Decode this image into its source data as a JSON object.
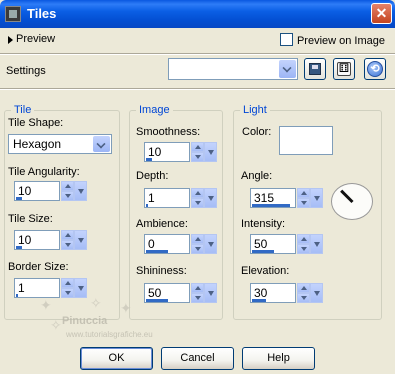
{
  "window": {
    "title": "Tiles",
    "close_glyph": "✕"
  },
  "preview": {
    "label": "Preview",
    "preview_on_image_label": "Preview on Image",
    "preview_on_image_checked": false
  },
  "settings": {
    "label": "Settings",
    "value": ""
  },
  "toolbar": {
    "save_icon": "save-icon",
    "random_icon": "dice-icon",
    "reset_icon": "reset-icon",
    "random_glyph": "⚅",
    "reset_glyph": "⟲"
  },
  "tile": {
    "title": "Tile",
    "shape_label": "Tile Shape:",
    "shape_value": "Hexagon",
    "angularity_label": "Tile Angularity:",
    "angularity_value": "10",
    "size_label": "Tile Size:",
    "size_value": "10",
    "border_label": "Border Size:",
    "border_value": "1"
  },
  "image": {
    "title": "Image",
    "smoothness_label": "Smoothness:",
    "smoothness_value": "10",
    "depth_label": "Depth:",
    "depth_value": "1",
    "ambience_label": "Ambience:",
    "ambience_value": "0",
    "shininess_label": "Shininess:",
    "shininess_value": "50"
  },
  "light": {
    "title": "Light",
    "color_label": "Color:",
    "color_value": "#ffffff",
    "angle_label": "Angle:",
    "angle_value": "315",
    "intensity_label": "Intensity:",
    "intensity_value": "50",
    "elevation_label": "Elevation:",
    "elevation_value": "30"
  },
  "buttons": {
    "ok": "OK",
    "cancel": "Cancel",
    "help": "Help"
  },
  "watermark": {
    "name": "Pinuccia",
    "url": "www.tutorialsgrafiche.eu"
  }
}
